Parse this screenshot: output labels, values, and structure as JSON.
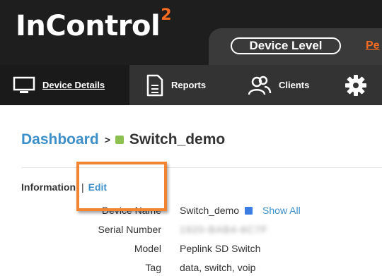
{
  "header": {
    "logo_text": "InControl",
    "logo_superscript": "2",
    "level_pill": "Device Level",
    "level_link": "Pe"
  },
  "nav": {
    "items": [
      {
        "label": "Device Details",
        "icon": "monitor-icon",
        "active": true
      },
      {
        "label": "Reports",
        "icon": "document-icon"
      },
      {
        "label": "Clients",
        "icon": "users-icon"
      },
      {
        "label": "",
        "icon": "gear-icon"
      }
    ]
  },
  "breadcrumb": {
    "root": "Dashboard",
    "separator": ">",
    "device": "Switch_demo",
    "status_color": "#8cc152"
  },
  "info": {
    "label": "Information",
    "separator": "|",
    "edit": "Edit"
  },
  "properties": [
    {
      "label": "Device Name",
      "value": "Switch_demo",
      "link": "Show All"
    },
    {
      "label": "Serial Number",
      "value": "1920-BAB4-6C7F"
    },
    {
      "label": "Model",
      "value": "Peplink SD Switch"
    },
    {
      "label": "Tag",
      "value": "data, switch, voip"
    }
  ],
  "colors": {
    "accent": "#3d8fc9",
    "brand": "#f26b21",
    "highlight": "#f08431"
  }
}
